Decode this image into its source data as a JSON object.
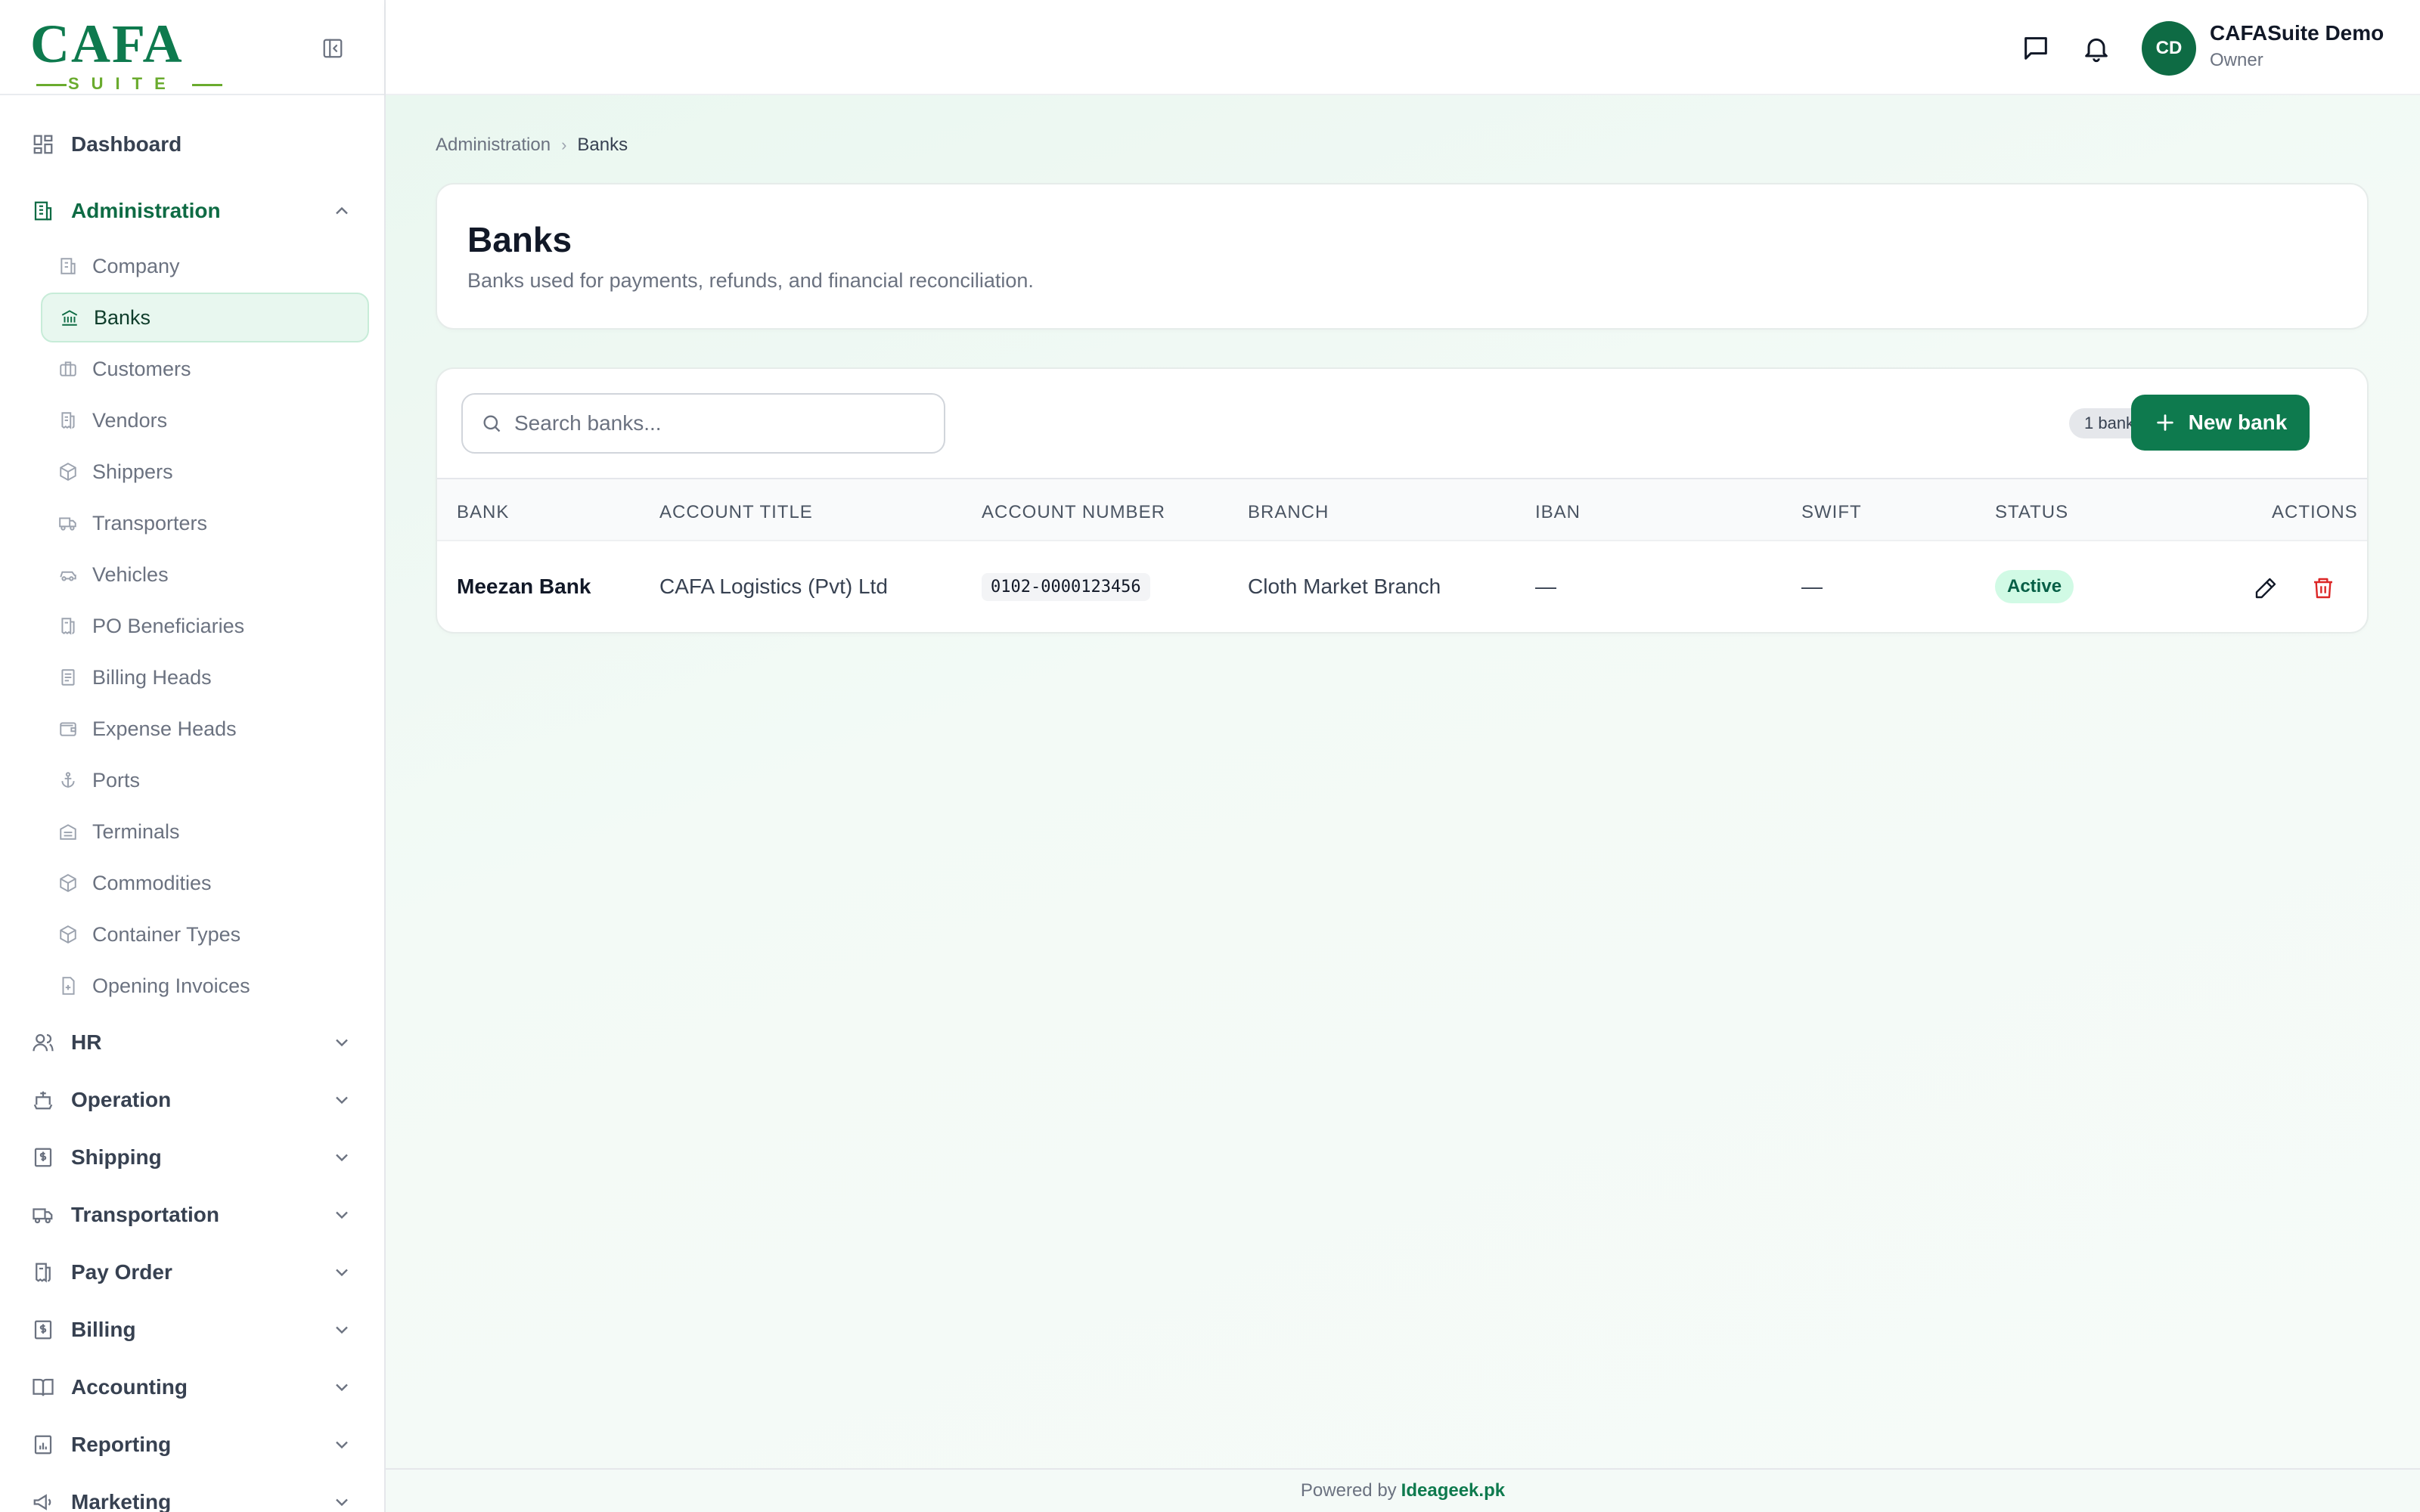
{
  "app": {
    "logo_text": "CAFA",
    "logo_sub": "SUITE"
  },
  "sidebar": {
    "items": [
      {
        "label": "Dashboard",
        "icon": "dashboard-icon"
      },
      {
        "label": "Administration",
        "icon": "building-icon",
        "expanded": true
      },
      {
        "label": "HR",
        "icon": "users-icon"
      },
      {
        "label": "Operation",
        "icon": "ship-icon"
      },
      {
        "label": "Shipping",
        "icon": "dollar-doc-icon"
      },
      {
        "label": "Transportation",
        "icon": "truck-icon"
      },
      {
        "label": "Pay Order",
        "icon": "receipt-icon"
      },
      {
        "label": "Billing",
        "icon": "dollar-doc-icon"
      },
      {
        "label": "Accounting",
        "icon": "book-icon"
      },
      {
        "label": "Reporting",
        "icon": "report-icon"
      },
      {
        "label": "Marketing",
        "icon": "megaphone-icon"
      }
    ],
    "admin_children": [
      {
        "label": "Company",
        "icon": "building-icon"
      },
      {
        "label": "Banks",
        "icon": "bank-icon",
        "active": true
      },
      {
        "label": "Customers",
        "icon": "briefcase-icon"
      },
      {
        "label": "Vendors",
        "icon": "receipt-icon"
      },
      {
        "label": "Shippers",
        "icon": "package-icon"
      },
      {
        "label": "Transporters",
        "icon": "truck-icon"
      },
      {
        "label": "Vehicles",
        "icon": "car-icon"
      },
      {
        "label": "PO Beneficiaries",
        "icon": "receipt-icon"
      },
      {
        "label": "Billing Heads",
        "icon": "document-icon"
      },
      {
        "label": "Expense Heads",
        "icon": "wallet-icon"
      },
      {
        "label": "Ports",
        "icon": "anchor-icon"
      },
      {
        "label": "Terminals",
        "icon": "warehouse-icon"
      },
      {
        "label": "Commodities",
        "icon": "package-icon"
      },
      {
        "label": "Container Types",
        "icon": "package-icon"
      },
      {
        "label": "Opening Invoices",
        "icon": "file-plus-icon"
      }
    ]
  },
  "topbar": {
    "avatar_initials": "CD",
    "user_name": "CAFASuite Demo",
    "user_role": "Owner"
  },
  "breadcrumb": {
    "parent": "Administration",
    "current": "Banks"
  },
  "page": {
    "title": "Banks",
    "subtitle": "Banks used for payments, refunds, and financial reconciliation."
  },
  "toolbar": {
    "search_placeholder": "Search banks...",
    "count_label": "1 bank",
    "new_button_label": "New bank"
  },
  "table": {
    "columns": [
      "BANK",
      "ACCOUNT TITLE",
      "ACCOUNT NUMBER",
      "BRANCH",
      "IBAN",
      "SWIFT",
      "STATUS",
      "ACTIONS"
    ],
    "rows": [
      {
        "bank": "Meezan Bank",
        "account_title": "CAFA Logistics (Pvt) Ltd",
        "account_number": "0102-0000123456",
        "branch": "Cloth Market Branch",
        "iban": "—",
        "swift": "—",
        "status": "Active"
      }
    ]
  },
  "footer": {
    "prefix": "Powered by",
    "link": "Ideageek.pk"
  },
  "colors": {
    "brand": "#0e7a4e",
    "brand_light": "#6aab2e",
    "active_bg": "#e8f7ef",
    "status_active_bg": "#d1fae5",
    "delete": "#dc2626"
  }
}
